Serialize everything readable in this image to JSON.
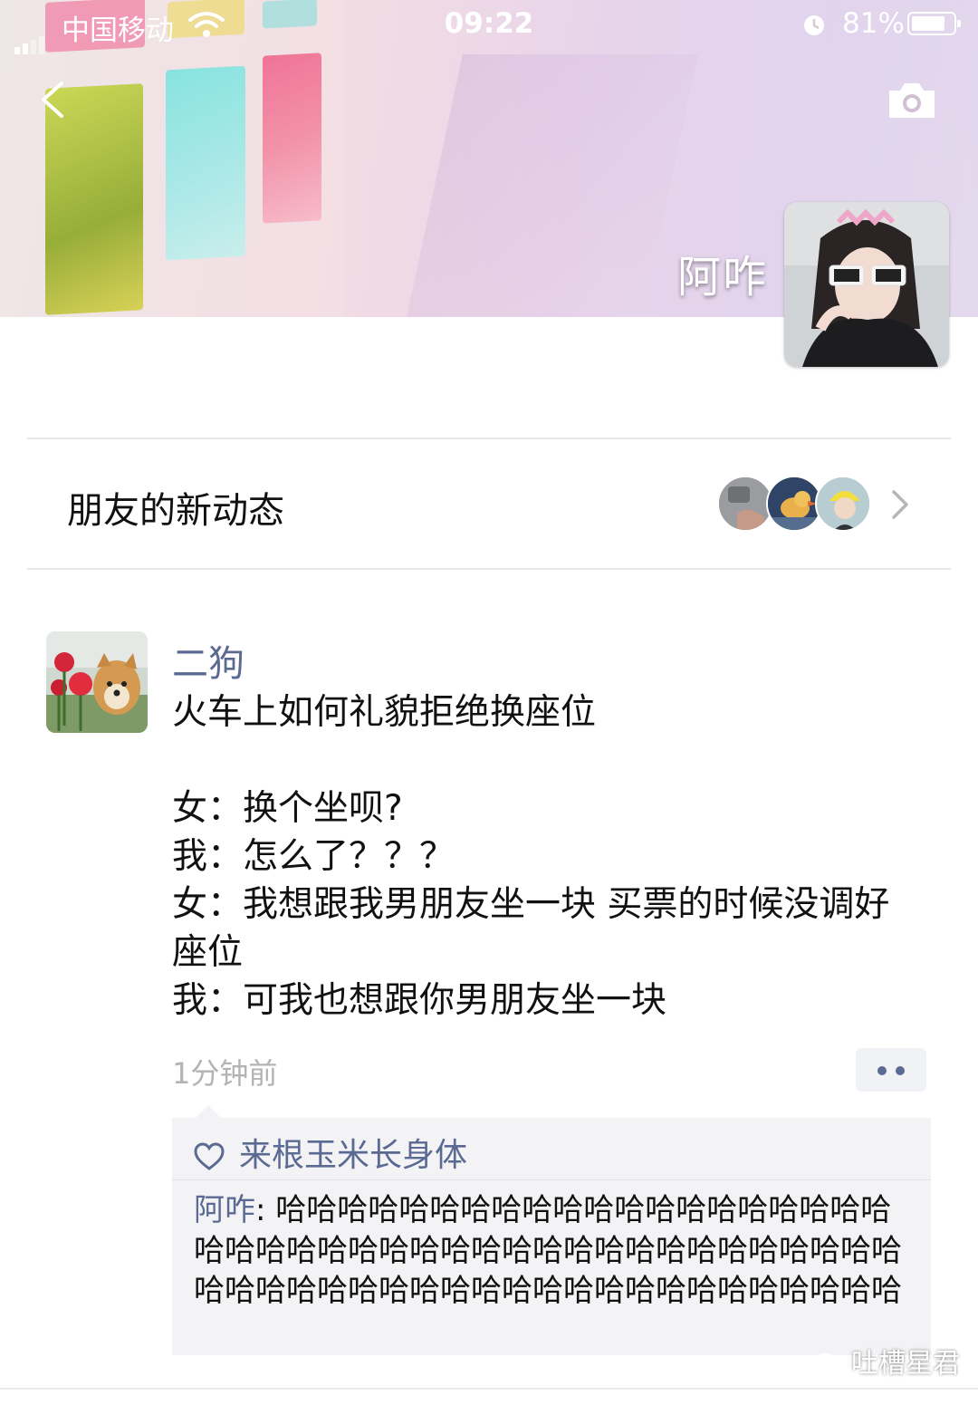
{
  "status_bar": {
    "carrier": "中国移动",
    "time": "09:22",
    "battery_percent": "81%",
    "battery_level": 0.81
  },
  "header": {
    "owner_name": "阿咋"
  },
  "friends_updates": {
    "label": "朋友的新动态"
  },
  "post": {
    "author": "二狗",
    "text": "火车上如何礼貌拒绝换座位\n\n女：换个坐呗?\n我：怎么了？？？\n女：我想跟我男朋友坐一块 买票的时候没调好座位\n我：可我也想跟你男朋友坐一块",
    "time": "1分钟前",
    "likes": "来根玉米长身体",
    "comment": {
      "author": "阿咋",
      "separator": ": ",
      "text": "哈哈哈哈哈哈哈哈哈哈哈哈哈哈哈哈哈哈哈哈哈哈哈哈哈哈哈哈哈哈哈哈哈哈哈哈哈哈哈哈哈哈哈哈哈哈哈哈哈哈哈哈哈哈哈哈哈哈哈哈哈哈哈哈哈哈"
    }
  },
  "watermark": "吐槽星君",
  "colors": {
    "link_blue": "#5b6a92",
    "time_gray": "#b3b3b3",
    "panel_bg": "#f3f3f5"
  },
  "icons": [
    "signal-icon",
    "wifi-icon",
    "alarm-icon",
    "battery-icon",
    "back-icon",
    "camera-icon",
    "chevron-right-icon",
    "more-dots-icon",
    "heart-icon",
    "wechat-icon"
  ]
}
